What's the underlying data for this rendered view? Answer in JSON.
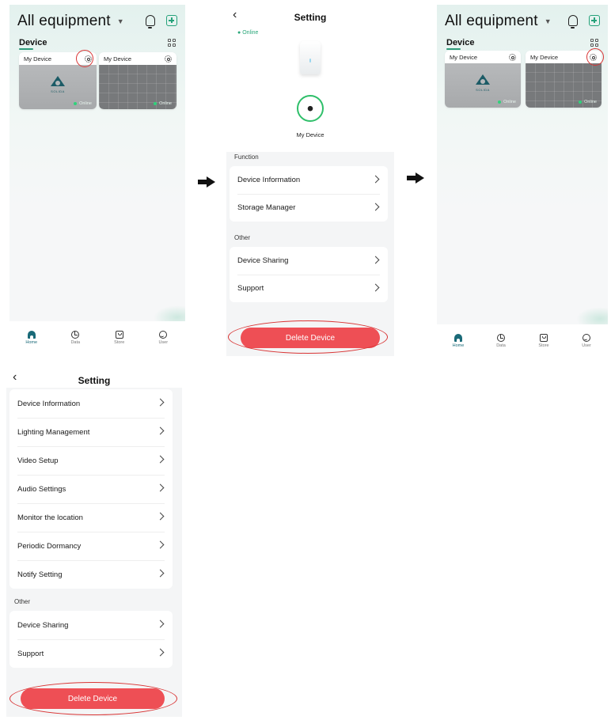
{
  "home": {
    "title": "All equipment",
    "section": "Device",
    "devices": [
      {
        "name": "My Device",
        "status": "Online",
        "logo_text": "SOLIDA"
      },
      {
        "name": "My Device",
        "status": "Online"
      }
    ],
    "tabs": [
      "Home",
      "Data",
      "Store",
      "User"
    ]
  },
  "setting_overview": {
    "title": "Setting",
    "status": "Online",
    "device_name": "My Device",
    "function_label": "Function",
    "function_items": [
      "Device Information",
      "Storage Manager"
    ],
    "other_label": "Other",
    "other_items": [
      "Device Sharing",
      "Support"
    ],
    "delete_label": "Delete Device"
  },
  "setting_full": {
    "title": "Setting",
    "items": [
      "Device Information",
      "Lighting Management",
      "Video Setup",
      "Audio Settings",
      "Monitor the location",
      "Periodic Dormancy",
      "Notify Setting"
    ],
    "other_label": "Other",
    "other_items": [
      "Device Sharing",
      "Support"
    ],
    "delete_label": "Delete Device"
  },
  "colors": {
    "accent": "#2e9b7a",
    "delete": "#ee4f55",
    "highlight": "#d93434",
    "online": "#2fd27b"
  }
}
